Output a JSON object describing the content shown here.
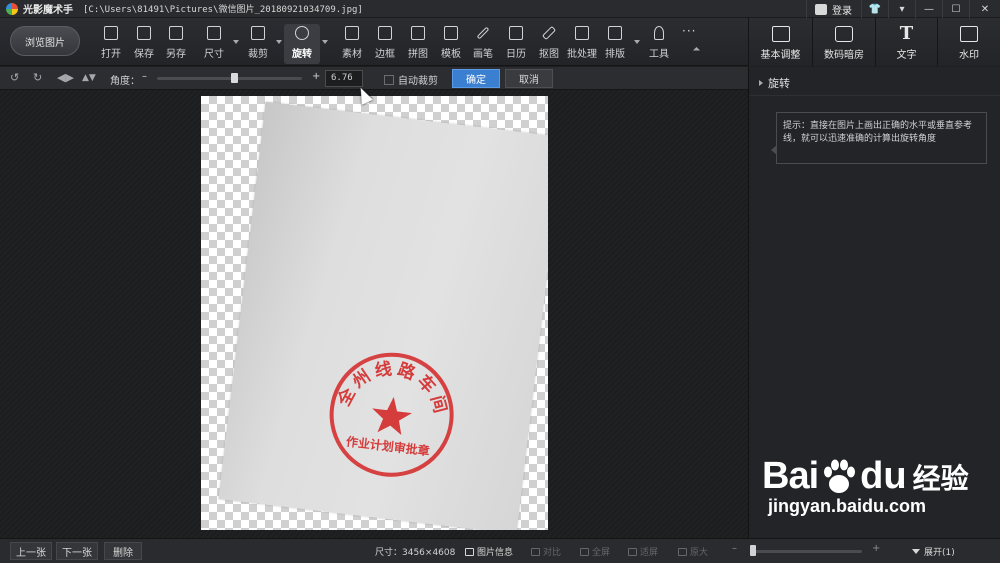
{
  "titlebar": {
    "app_name": "光影魔术手",
    "file_path": "[C:\\Users\\81491\\Pictures\\微信图片_20180921034709.jpg]",
    "login_label": "登录"
  },
  "toolbar": {
    "browse_label": "浏览图片",
    "tools": [
      {
        "label": "打开",
        "icon": "open-icon"
      },
      {
        "label": "保存",
        "icon": "save-icon"
      },
      {
        "label": "另存",
        "icon": "save-as-icon"
      },
      {
        "label": "尺寸",
        "icon": "resize-icon"
      },
      {
        "label": "裁剪",
        "icon": "crop-icon"
      },
      {
        "label": "旋转",
        "icon": "rotate-icon"
      },
      {
        "label": "素材",
        "icon": "material-icon"
      },
      {
        "label": "边框",
        "icon": "border-icon"
      },
      {
        "label": "拼图",
        "icon": "collage-icon"
      },
      {
        "label": "模板",
        "icon": "template-icon"
      },
      {
        "label": "画笔",
        "icon": "brush-icon"
      },
      {
        "label": "日历",
        "icon": "calendar-icon"
      },
      {
        "label": "抠图",
        "icon": "cutout-icon"
      },
      {
        "label": "批处理",
        "icon": "batch-icon"
      },
      {
        "label": "排版",
        "icon": "layout-icon"
      },
      {
        "label": "工具",
        "icon": "wrench-icon"
      }
    ],
    "more_label": "···"
  },
  "right_tabs": [
    {
      "label": "基本调整",
      "icon": "basic-adjust-icon"
    },
    {
      "label": "数码暗房",
      "icon": "darkroom-icon"
    },
    {
      "label": "文字",
      "icon": "text-icon"
    },
    {
      "label": "水印",
      "icon": "watermark-icon"
    }
  ],
  "rotate_bar": {
    "angle_label": "角度：",
    "minus": "–",
    "plus": "+",
    "angle_value": "6.76",
    "auto_crop_label": "自动裁剪",
    "auto_crop_checked": false,
    "confirm_label": "确定",
    "cancel_label": "取消",
    "slider_fraction": 0.53
  },
  "right_panel": {
    "section_title": "旋转",
    "tip_text": "提示：直接在图片上画出正确的水平或垂直参考线，就可以迅速准确的计算出旋转角度"
  },
  "image": {
    "rotation_degrees": 6.76,
    "seal_top_text": "全州线路车间",
    "seal_bottom_text": "作业计划审批章",
    "seal_color": "#d42a2a"
  },
  "statusbar": {
    "prev_label": "上一张",
    "next_label": "下一张",
    "delete_label": "删除",
    "size_text": "尺寸：3456×4608",
    "info_label": "图片信息",
    "compare_label": "对比",
    "fullscreen_label": "全屏",
    "fit_label": "适屏",
    "original_label": "原大",
    "zoom_fraction": 0.0,
    "expand_label": "展开(1)"
  },
  "watermark": {
    "brand_bai": "Bai",
    "brand_du": "du",
    "brand_jingyan": "经验",
    "url": "jingyan.baidu.com"
  },
  "colors": {
    "accent": "#3a7fd0",
    "background": "#1d1e20",
    "panel": "#232427"
  }
}
